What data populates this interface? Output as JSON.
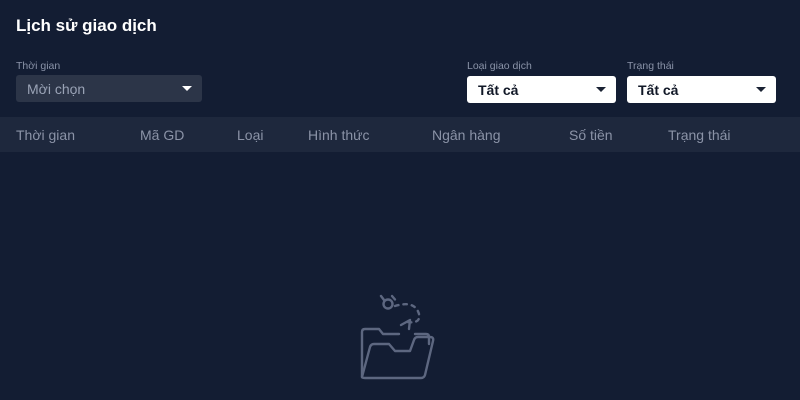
{
  "page": {
    "title": "Lịch sử giao dịch"
  },
  "filters": {
    "time": {
      "label": "Thời gian",
      "value": "Mời chọn"
    },
    "type": {
      "label": "Loại giao dịch",
      "value": "Tất cả"
    },
    "status": {
      "label": "Trạng thái",
      "value": "Tất cả"
    }
  },
  "table": {
    "columns": [
      "Thời gian",
      "Mã GD",
      "Loại",
      "Hình thức",
      "Ngân hàng",
      "Số tiền",
      "Trạng thái"
    ]
  },
  "empty_state": {
    "icon": "empty-folder-icon"
  },
  "colors": {
    "background": "#131d33",
    "header_row": "#1e283d",
    "dark_select": "#2c3548",
    "muted_text": "#8b93a7"
  }
}
